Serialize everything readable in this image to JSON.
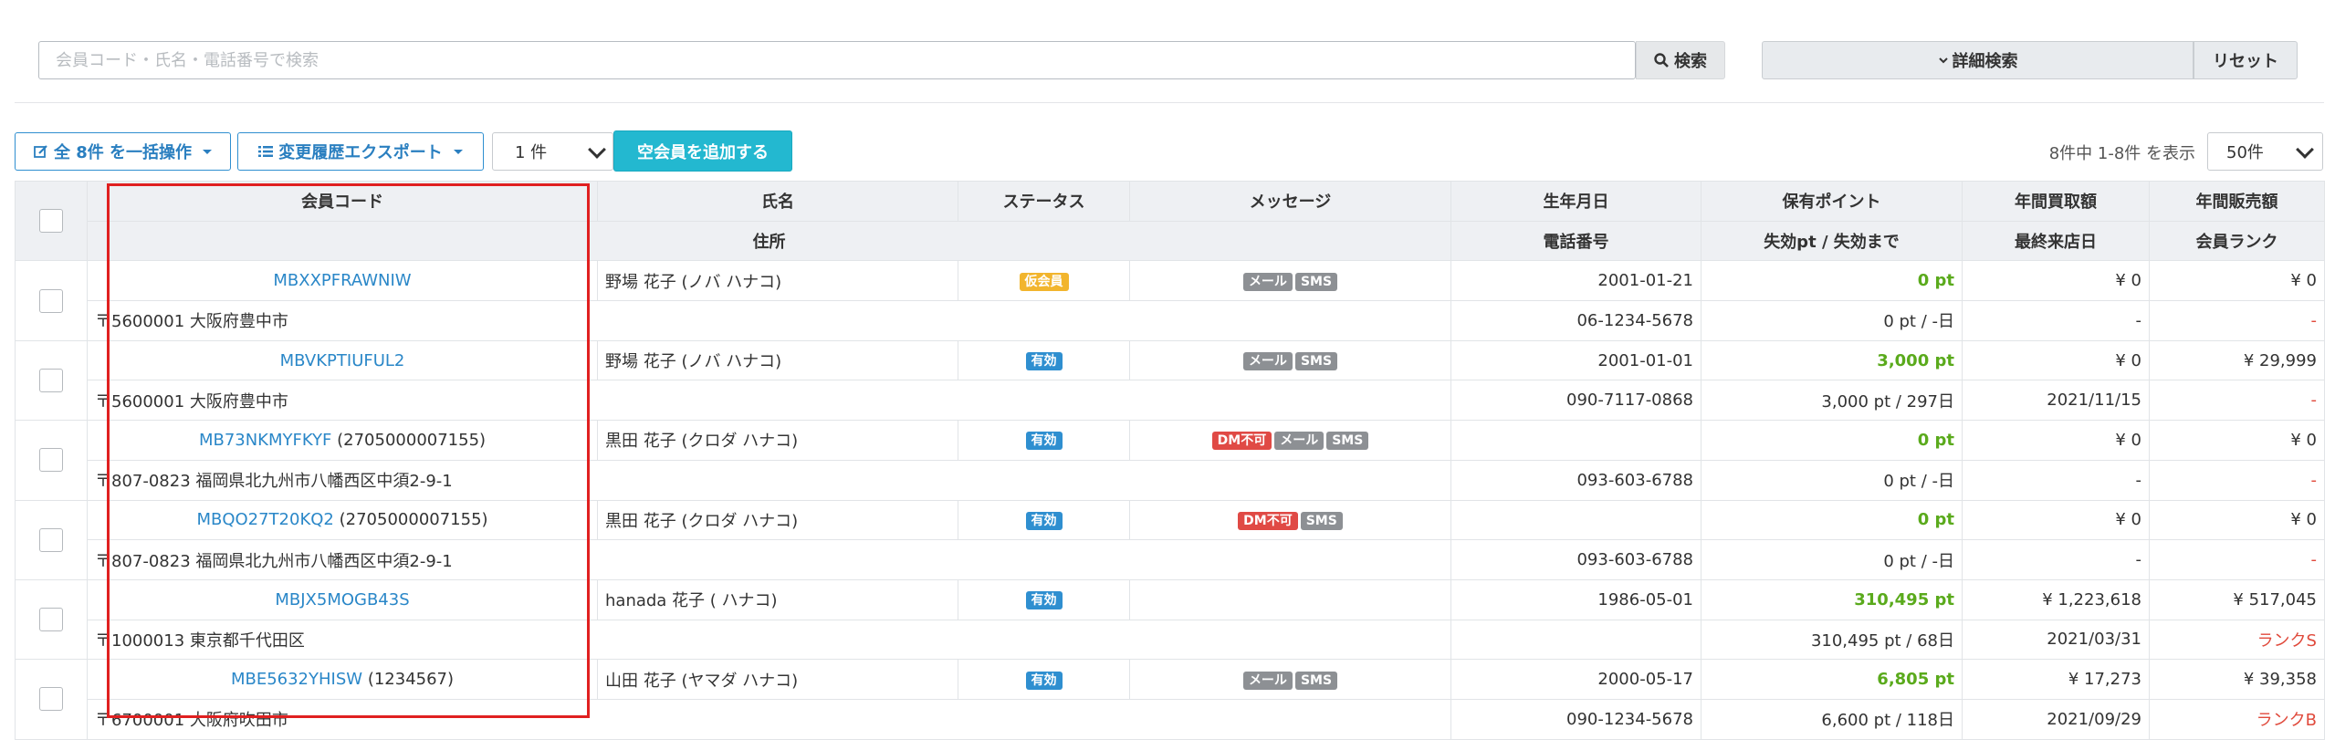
{
  "search": {
    "placeholder": "会員コード・氏名・電話番号で検索",
    "button": "検索",
    "advanced": "詳細検索",
    "reset": "リセット"
  },
  "toolbar": {
    "bulk": "全 8件 を一括操作",
    "export": "変更履歴エクスポート",
    "count": "1 件",
    "add": "空会員を追加する",
    "paging": "8件中 1-8件 を表示",
    "per_page": "50件"
  },
  "headers": {
    "row1": [
      "会員コード",
      "氏名",
      "ステータス",
      "メッセージ",
      "生年月日",
      "保有ポイント",
      "年間買取額",
      "年間販売額"
    ],
    "row2": [
      "住所",
      "電話番号",
      "失効pt / 失効まで",
      "最終来店日",
      "会員ランク"
    ]
  },
  "colors": {
    "accent": "#2f8fd0",
    "add_button": "#23b8d0",
    "points": "#5aaa1c",
    "alert": "#e04a3c",
    "highlight": "#e02020"
  },
  "members": [
    {
      "code": "MBXXPFRAWNIW",
      "extra": "",
      "name": "野場 花子 (ノバ ハナコ)",
      "status": "仮会員",
      "status_color": "yellow",
      "tags": [
        "メール",
        "SMS"
      ],
      "dm": "",
      "birth": "2001-01-21",
      "points": "0 pt",
      "buy": "¥ 0",
      "sell": "¥ 0",
      "address": "〒5600001 大阪府豊中市",
      "phone": "06-1234-5678",
      "expire": "0 pt / -日",
      "last_visit": "-",
      "rank": "-"
    },
    {
      "code": "MBVKPTIUFUL2",
      "extra": "",
      "name": "野場 花子 (ノバ ハナコ)",
      "status": "有効",
      "status_color": "blue",
      "tags": [
        "メール",
        "SMS"
      ],
      "dm": "",
      "birth": "2001-01-01",
      "points": "3,000 pt",
      "buy": "¥ 0",
      "sell": "¥ 29,999",
      "address": "〒5600001 大阪府豊中市",
      "phone": "090-7117-0868",
      "expire": "3,000 pt / 297日",
      "last_visit": "2021/11/15",
      "rank": "-"
    },
    {
      "code": "MB73NKMYFKYF",
      "extra": "(2705000007155)",
      "name": "黒田 花子 (クロダ ハナコ)",
      "status": "有効",
      "status_color": "blue",
      "tags": [
        "メール",
        "SMS"
      ],
      "dm": "DM不可",
      "birth": "",
      "points": "0 pt",
      "buy": "¥ 0",
      "sell": "¥ 0",
      "address": "〒807-0823 福岡県北九州市八幡西区中須2-9-1",
      "phone": "093-603-6788",
      "expire": "0 pt / -日",
      "last_visit": "-",
      "rank": "-"
    },
    {
      "code": "MBQO27T20KQ2",
      "extra": "(2705000007155)",
      "name": "黒田 花子 (クロダ ハナコ)",
      "status": "有効",
      "status_color": "blue",
      "tags": [
        "SMS"
      ],
      "dm": "DM不可",
      "birth": "",
      "points": "0 pt",
      "buy": "¥ 0",
      "sell": "¥ 0",
      "address": "〒807-0823 福岡県北九州市八幡西区中須2-9-1",
      "phone": "093-603-6788",
      "expire": "0 pt / -日",
      "last_visit": "-",
      "rank": "-"
    },
    {
      "code": "MBJX5MOGB43S",
      "extra": "",
      "name": "hanada 花子 ( ハナコ)",
      "status": "有効",
      "status_color": "blue",
      "tags": [],
      "dm": "",
      "birth": "1986-05-01",
      "points": "310,495 pt",
      "buy": "¥ 1,223,618",
      "sell": "¥ 517,045",
      "address": "〒1000013 東京都千代田区",
      "phone": "",
      "expire": "310,495 pt / 68日",
      "last_visit": "2021/03/31",
      "rank": "ランクS"
    },
    {
      "code": "MBE5632YHISW",
      "extra": "(1234567)",
      "name": "山田 花子 (ヤマダ ハナコ)",
      "status": "有効",
      "status_color": "blue",
      "tags": [
        "メール",
        "SMS"
      ],
      "dm": "",
      "birth": "2000-05-17",
      "points": "6,805 pt",
      "buy": "¥ 17,273",
      "sell": "¥ 39,358",
      "address": "〒6700001 大阪府吹田市",
      "phone": "090-1234-5678",
      "expire": "6,600 pt / 118日",
      "last_visit": "2021/09/29",
      "rank": "ランクB"
    }
  ]
}
